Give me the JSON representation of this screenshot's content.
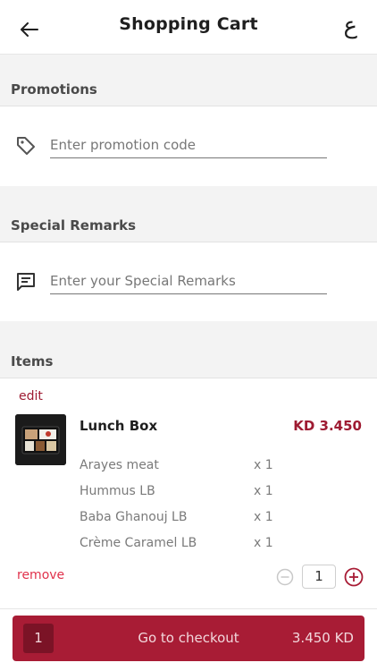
{
  "header": {
    "title": "Shopping Cart",
    "language_toggle": "ع",
    "back_icon": "arrow-left-icon"
  },
  "promotions": {
    "heading": "Promotions",
    "icon": "tag-icon",
    "placeholder": "Enter promotion code"
  },
  "remarks": {
    "heading": "Special Remarks",
    "icon": "message-icon",
    "placeholder": "Enter your Special Remarks"
  },
  "items": {
    "heading": "Items",
    "edit_label": "edit",
    "remove_label": "remove",
    "list": [
      {
        "name": "Lunch Box",
        "price": "KD 3.450",
        "quantity": "1",
        "components": [
          {
            "name": "Arayes meat",
            "qty": "x 1"
          },
          {
            "name": "Hummus LB",
            "qty": "x 1"
          },
          {
            "name": "Baba Ghanouj LB",
            "qty": "x 1"
          },
          {
            "name": "Crème Caramel LB",
            "qty": "x 1"
          }
        ]
      }
    ]
  },
  "checkout": {
    "count": "1",
    "label": "Go to checkout",
    "total": "3.450 KD"
  },
  "colors": {
    "accent": "#a81c35",
    "price": "#9e1b32",
    "remove": "#e0314b",
    "section_bg": "#f3f3f3"
  }
}
